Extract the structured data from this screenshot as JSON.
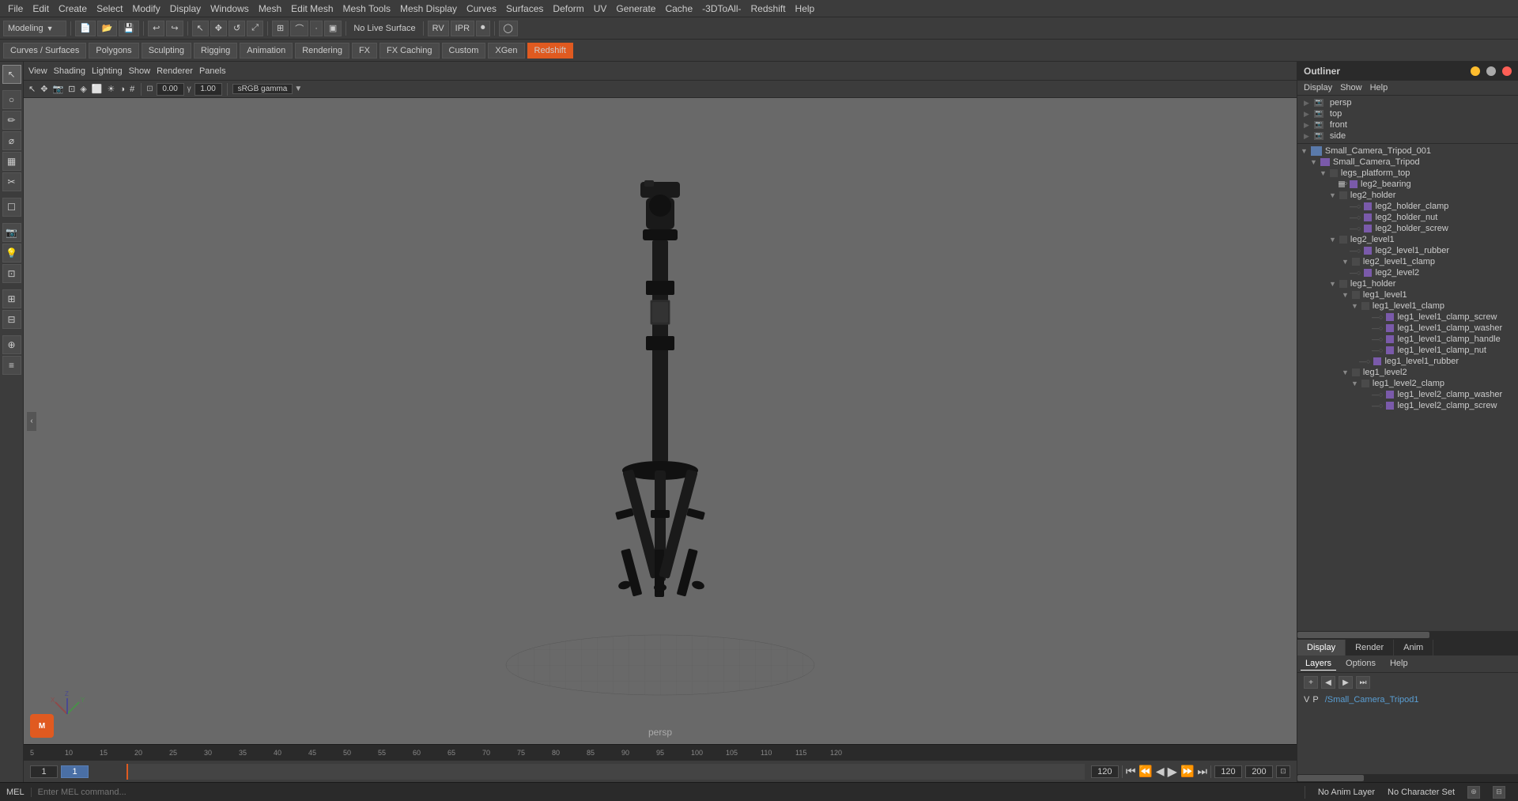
{
  "app": {
    "title": "Outliner"
  },
  "menu_bar": {
    "items": [
      "File",
      "Edit",
      "Create",
      "Select",
      "Modify",
      "Display",
      "Windows",
      "Mesh",
      "Edit Mesh",
      "Mesh Tools",
      "Mesh Display",
      "Curves",
      "Surfaces",
      "Deform",
      "UV",
      "Generate",
      "Cache",
      "-3DToAll-",
      "Redshift",
      "Help"
    ]
  },
  "workspace_selector": {
    "label": "Modeling",
    "value": "Modeling"
  },
  "toolbar2": {
    "items": [
      "Curves / Surfaces",
      "Polygons",
      "Sculpting",
      "Rigging",
      "Animation",
      "Rendering",
      "FX",
      "FX Caching",
      "Custom",
      "XGen",
      "Redshift"
    ]
  },
  "toolbar3": {
    "icons": [
      "RV",
      "IPR",
      "●"
    ]
  },
  "no_live_surface": "No Live Surface",
  "viewport_menus": [
    "View",
    "Shading",
    "Lighting",
    "Show",
    "Renderer",
    "Panels"
  ],
  "gamma_label": "sRGB gamma",
  "gamma_value": "1.00",
  "exposure_value": "0.00",
  "viewport_label": "persp",
  "camera_views": [
    {
      "name": "persp",
      "label": "persp"
    },
    {
      "name": "top",
      "label": "top"
    },
    {
      "name": "front",
      "label": "front"
    },
    {
      "name": "side",
      "label": "side"
    }
  ],
  "outliner": {
    "title": "Outliner",
    "menu_items": [
      "Display",
      "Show",
      "Help"
    ],
    "tree": [
      {
        "id": "small_camera_tripod_001",
        "label": "Small_Camera_Tripod_001",
        "depth": 0,
        "has_children": true,
        "type": "group"
      },
      {
        "id": "small_camera_tripod",
        "label": "Small_Camera_Tripod",
        "depth": 1,
        "has_children": true,
        "type": "mesh"
      },
      {
        "id": "legs_platform_top",
        "label": "legs_platform_top",
        "depth": 2,
        "has_children": true,
        "type": "group"
      },
      {
        "id": "leg2_bearing",
        "label": "leg2_bearing",
        "depth": 3,
        "has_children": false,
        "type": "mesh"
      },
      {
        "id": "leg2_holder",
        "label": "leg2_holder",
        "depth": 3,
        "has_children": true,
        "type": "group"
      },
      {
        "id": "leg2_holder_clamp",
        "label": "leg2_holder_clamp",
        "depth": 4,
        "has_children": false,
        "type": "mesh"
      },
      {
        "id": "leg2_holder_nut",
        "label": "leg2_holder_nut",
        "depth": 4,
        "has_children": false,
        "type": "mesh"
      },
      {
        "id": "leg2_holder_screw",
        "label": "leg2_holder_screw",
        "depth": 4,
        "has_children": false,
        "type": "mesh"
      },
      {
        "id": "leg2_level1",
        "label": "leg2_level1",
        "depth": 3,
        "has_children": true,
        "type": "group"
      },
      {
        "id": "leg2_level1_rubber",
        "label": "leg2_level1_rubber",
        "depth": 4,
        "has_children": false,
        "type": "mesh"
      },
      {
        "id": "leg2_level1_clamp",
        "label": "leg2_level1_clamp",
        "depth": 4,
        "has_children": true,
        "type": "group"
      },
      {
        "id": "leg2_level2",
        "label": "leg2_level2",
        "depth": 4,
        "has_children": false,
        "type": "mesh"
      },
      {
        "id": "leg1_holder",
        "label": "leg1_holder",
        "depth": 3,
        "has_children": true,
        "type": "group"
      },
      {
        "id": "leg1_level1",
        "label": "leg1_level1",
        "depth": 4,
        "has_children": true,
        "type": "group"
      },
      {
        "id": "leg1_level1_clamp",
        "label": "leg1_level1_clamp",
        "depth": 4,
        "has_children": true,
        "type": "group"
      },
      {
        "id": "leg1_level1_clamp_screw",
        "label": "leg1_level1_clamp_screw",
        "depth": 5,
        "has_children": false,
        "type": "mesh"
      },
      {
        "id": "leg1_level1_clamp_washer",
        "label": "leg1_level1_clamp_washer",
        "depth": 5,
        "has_children": false,
        "type": "mesh"
      },
      {
        "id": "leg1_level1_clamp_handle",
        "label": "leg1_level1_clamp_handle",
        "depth": 5,
        "has_children": false,
        "type": "mesh"
      },
      {
        "id": "leg1_level1_clamp_nut",
        "label": "leg1_level1_clamp_nut",
        "depth": 5,
        "has_children": false,
        "type": "mesh"
      },
      {
        "id": "leg1_level1_rubber",
        "label": "leg1_level1_rubber",
        "depth": 4,
        "has_children": false,
        "type": "mesh"
      },
      {
        "id": "leg1_level2",
        "label": "leg1_level2",
        "depth": 4,
        "has_children": true,
        "type": "group"
      },
      {
        "id": "leg1_level2_clamp",
        "label": "leg1_level2_clamp",
        "depth": 5,
        "has_children": true,
        "type": "group"
      },
      {
        "id": "leg1_level2_clamp_washer",
        "label": "leg1_level2_clamp_washer",
        "depth": 6,
        "has_children": false,
        "type": "mesh"
      },
      {
        "id": "leg1_level2_clamp_screw",
        "label": "leg1_level2_clamp_screw",
        "depth": 6,
        "has_children": false,
        "type": "mesh"
      }
    ]
  },
  "lower_panel": {
    "tabs": [
      "Display",
      "Render",
      "Anim"
    ],
    "active_tab": "Display",
    "sub_tabs": [
      "Layers",
      "Options",
      "Help"
    ],
    "active_sub_tab": "Layers",
    "v_label": "V",
    "p_label": "P",
    "path": "/Small_Camera_Tripod1"
  },
  "timeline": {
    "start_frame": "1",
    "end_frame": "120",
    "current_frame": "1",
    "range_start": "1",
    "range_end": "120",
    "playback_end": "200",
    "ruler_marks": [
      "5",
      "10",
      "15",
      "20",
      "25",
      "30",
      "35",
      "40",
      "45",
      "50",
      "55",
      "60",
      "65",
      "70",
      "75",
      "80",
      "85",
      "90",
      "95",
      "100",
      "105",
      "110",
      "115",
      "120"
    ]
  },
  "status_bar": {
    "no_anim_layer": "No Anim Layer",
    "no_char_set": "No Character Set",
    "mel_label": "MEL"
  }
}
